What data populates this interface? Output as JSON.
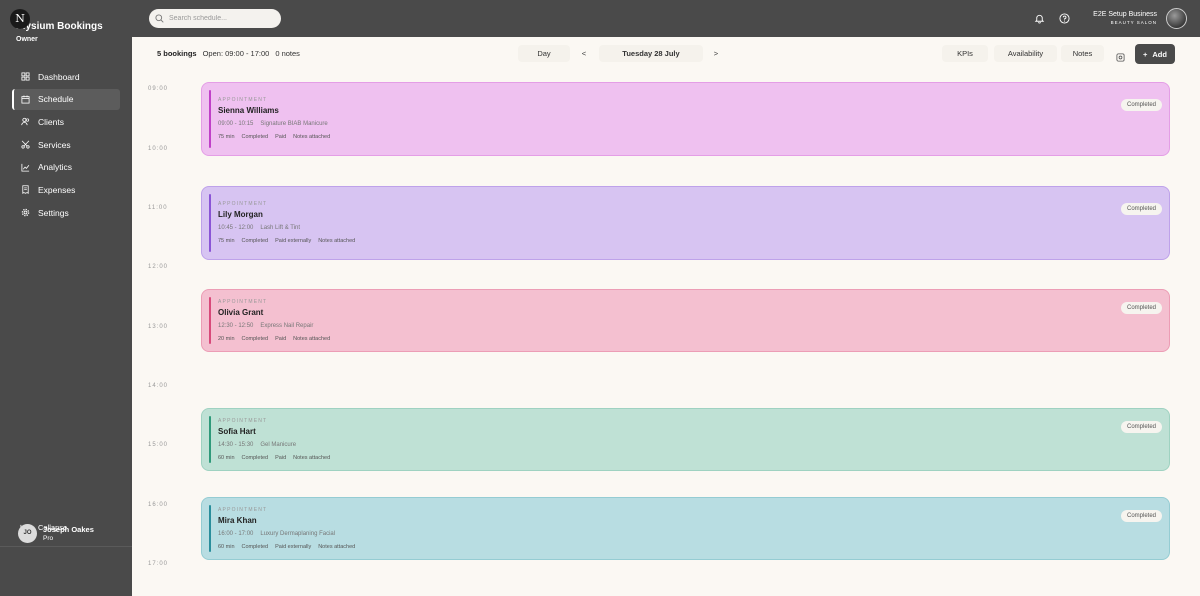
{
  "app": {
    "logo_letter": "N",
    "brand": "Elysium Bookings",
    "role": "Owner"
  },
  "search": {
    "placeholder": "Search schedule..."
  },
  "business": {
    "name": "E2E Setup Business",
    "type": "BEAUTY SALON"
  },
  "nav": {
    "items": [
      {
        "label": "Dashboard",
        "icon": "grid-icon"
      },
      {
        "label": "Schedule",
        "icon": "calendar-icon"
      },
      {
        "label": "Clients",
        "icon": "users-icon"
      },
      {
        "label": "Services",
        "icon": "scissors-icon"
      },
      {
        "label": "Analytics",
        "icon": "chart-icon"
      },
      {
        "label": "Expenses",
        "icon": "receipt-icon"
      },
      {
        "label": "Settings",
        "icon": "gear-icon"
      }
    ],
    "active": "Schedule",
    "collapse_label": "Collapse"
  },
  "user": {
    "initials": "JO",
    "name": "Joseph Oakes",
    "plan": "Pro"
  },
  "toolbar": {
    "bookings": "5 bookings",
    "open_hours": "Open: 09:00 - 17:00",
    "notes_count": "0 notes",
    "view_label": "Day",
    "prev_label": "<",
    "date_label": "Tuesday 28 July",
    "next_label": ">",
    "kpis_label": "KPIs",
    "availability_label": "Availability",
    "notes_label": "Notes",
    "add_label": "Add",
    "add_symbol": "+"
  },
  "time_labels": [
    "09:00",
    "10:00",
    "11:00",
    "12:00",
    "13:00",
    "14:00",
    "15:00",
    "16:00",
    "17:00"
  ],
  "appointments": [
    {
      "kind": "APPOINTMENT",
      "client": "Sienna Williams",
      "time": "09:00 - 10:15",
      "service": "Signature BIAB Manicure",
      "duration": "75 min",
      "status": "Completed",
      "payment": "Paid",
      "notes": "Notes attached",
      "badge": "Completed",
      "colors": {
        "bg": "#efc1f0",
        "border": "#e49ee6",
        "bar": "#c040c8"
      }
    },
    {
      "kind": "APPOINTMENT",
      "client": "Lily Morgan",
      "time": "10:45 - 12:00",
      "service": "Lash Lift & Tint",
      "duration": "75 min",
      "status": "Completed",
      "payment": "Paid externally",
      "notes": "Notes attached",
      "badge": "Completed",
      "colors": {
        "bg": "#d7c4f2",
        "border": "#bea2ea",
        "bar": "#8a55d6"
      }
    },
    {
      "kind": "APPOINTMENT",
      "client": "Olivia Grant",
      "time": "12:30 - 12:50",
      "service": "Express Nail Repair",
      "duration": "20 min",
      "status": "Completed",
      "payment": "Paid",
      "notes": "Notes attached",
      "badge": "Completed",
      "colors": {
        "bg": "#f4c0d0",
        "border": "#ec9db5",
        "bar": "#d84a7a"
      }
    },
    {
      "kind": "APPOINTMENT",
      "client": "Sofia Hart",
      "time": "14:30 - 15:30",
      "service": "Gel Manicure",
      "duration": "60 min",
      "status": "Completed",
      "payment": "Paid",
      "notes": "Notes attached",
      "badge": "Completed",
      "colors": {
        "bg": "#bfe1d5",
        "border": "#9fd2c1",
        "bar": "#2f9a7a"
      }
    },
    {
      "kind": "APPOINTMENT",
      "client": "Mira Khan",
      "time": "16:00 - 17:00",
      "service": "Luxury Dermaplaning Facial",
      "duration": "60 min",
      "status": "Completed",
      "payment": "Paid externally",
      "notes": "Notes attached",
      "badge": "Completed",
      "colors": {
        "bg": "#b8dde2",
        "border": "#95ccd3",
        "bar": "#2a8e9c"
      }
    }
  ]
}
